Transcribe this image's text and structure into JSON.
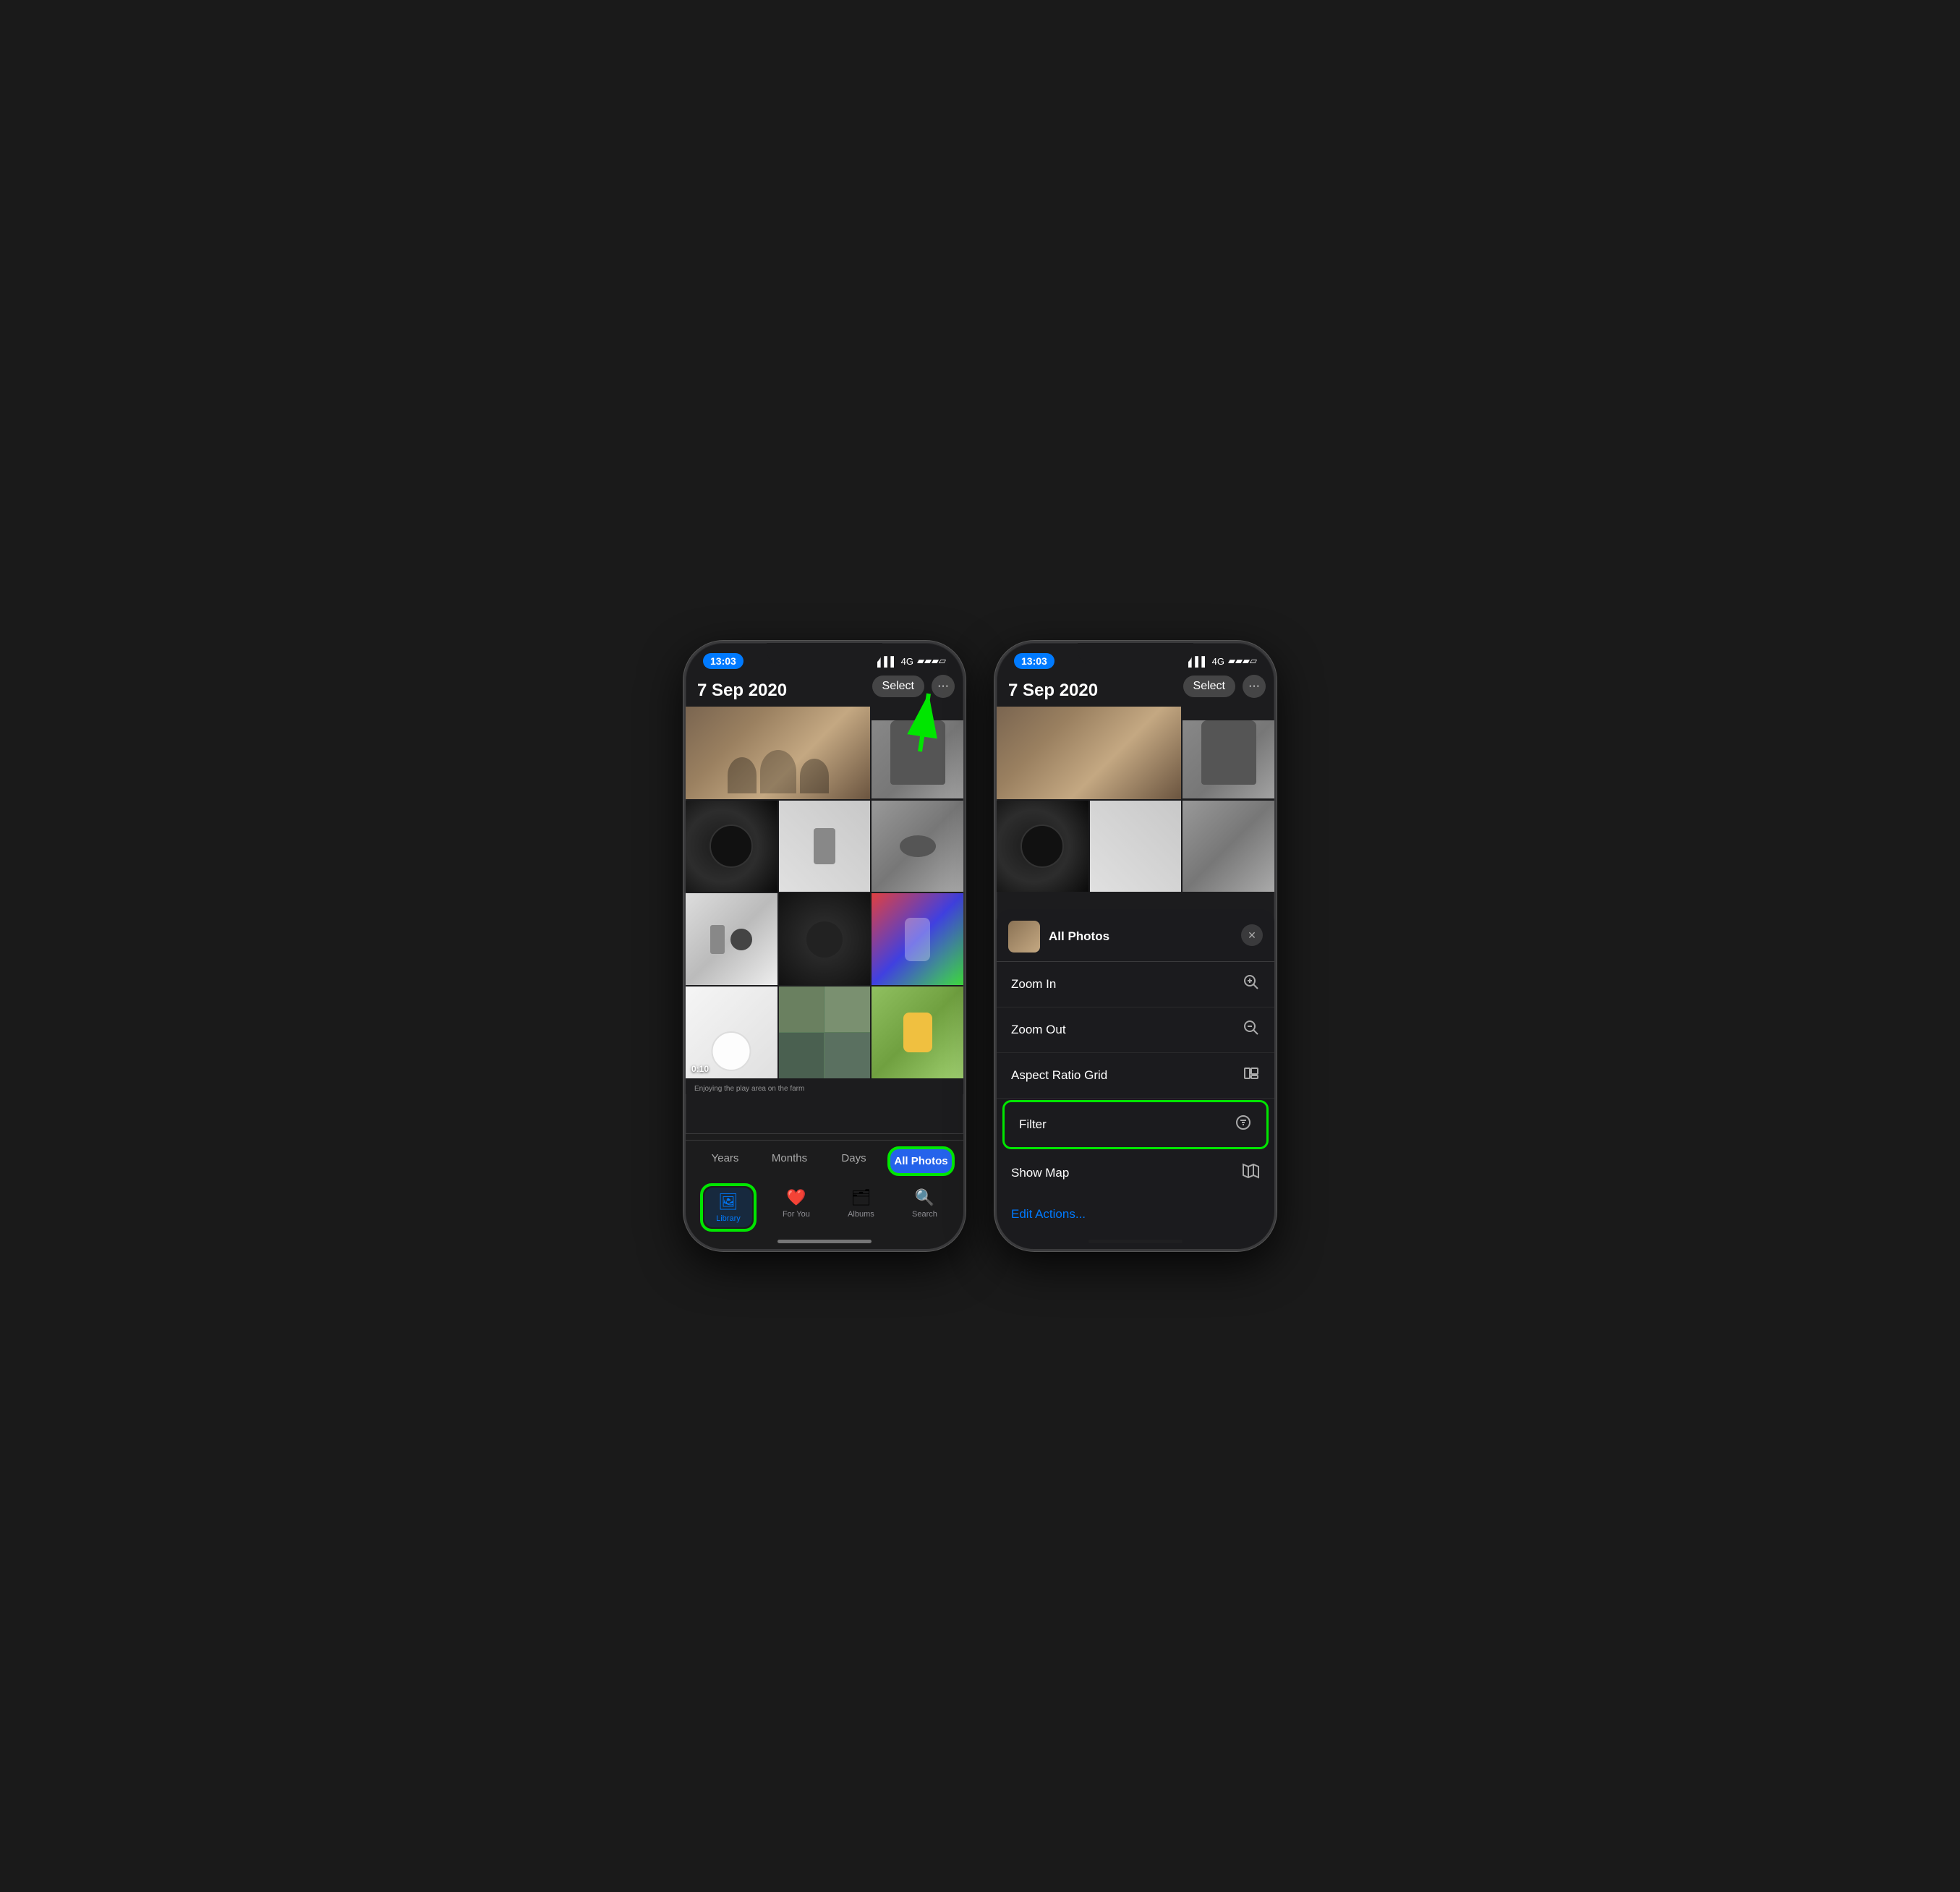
{
  "phone1": {
    "statusBar": {
      "time": "13:03",
      "signal": "4G",
      "battery": "▮▮▮"
    },
    "header": {
      "date": "7 Sep 2020",
      "selectLabel": "Select",
      "moreLabel": "···"
    },
    "grid": {
      "cells": [
        {
          "id": 1,
          "type": "faces",
          "span": 2
        },
        {
          "id": 2,
          "type": "cup"
        },
        {
          "id": 3,
          "type": "spk-dark"
        },
        {
          "id": 4,
          "type": "cable"
        },
        {
          "id": 5,
          "type": "spk-round"
        },
        {
          "id": 6,
          "type": "holder-side"
        },
        {
          "id": 7,
          "type": "holder-front"
        },
        {
          "id": 8,
          "type": "phone-colorful"
        },
        {
          "id": 9,
          "type": "homepod",
          "video": "0:10"
        },
        {
          "id": 10,
          "type": "grid-baby"
        },
        {
          "id": 11,
          "type": "baby-outside"
        }
      ]
    },
    "yearTabs": {
      "years": "Years",
      "months": "Months",
      "days": "Days",
      "allPhotos": "All Photos"
    },
    "navTabs": [
      {
        "id": "library",
        "label": "Library",
        "active": true,
        "icon": "🖼"
      },
      {
        "id": "for-you",
        "label": "For You",
        "active": false,
        "icon": "❤"
      },
      {
        "id": "albums",
        "label": "Albums",
        "active": false,
        "icon": "🗂"
      },
      {
        "id": "search",
        "label": "Search",
        "active": false,
        "icon": "🔍"
      }
    ],
    "caption": "Enjoying the play area on the farm"
  },
  "phone2": {
    "statusBar": {
      "time": "13:03",
      "signal": "4G"
    },
    "header": {
      "date": "7 Sep 2020",
      "selectLabel": "Select",
      "moreLabel": "···"
    },
    "contextMenu": {
      "title": "All Photos",
      "closeIcon": "✕",
      "items": [
        {
          "id": "zoom-in",
          "label": "Zoom In",
          "icon": "⊕"
        },
        {
          "id": "zoom-out",
          "label": "Zoom Out",
          "icon": "⊖"
        },
        {
          "id": "aspect-ratio",
          "label": "Aspect Ratio Grid",
          "icon": "⊞"
        },
        {
          "id": "filter",
          "label": "Filter",
          "icon": "☰",
          "highlighted": true
        },
        {
          "id": "show-map",
          "label": "Show Map",
          "icon": "🗺"
        }
      ],
      "editActions": "Edit Actions..."
    }
  },
  "arrow": {
    "label": "green arrow pointing to dots button"
  }
}
